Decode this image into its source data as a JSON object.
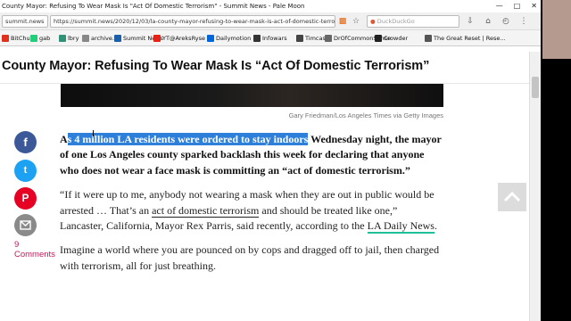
{
  "browser": {
    "tab_title": "County Mayor: Refusing To Wear Mask Is \"Act Of Domestic Terrorism\" - Summit News - Pale Moon",
    "site_identity": "summit.news",
    "url": "https://summit.news/2020/12/03/la-county-mayor-refusing-to-wear-mask-is-act-of-domestic-terrorism/",
    "search_placeholder": "DuckDuckGo"
  },
  "bookmarks": [
    {
      "label": "BitChute",
      "color": "#e0301e"
    },
    {
      "label": "gab",
      "color": "#21cf7a"
    },
    {
      "label": "lbry",
      "color": "#2f9176"
    },
    {
      "label": "archive.is",
      "color": "#888888"
    },
    {
      "label": "Summit News",
      "color": "#1b5fa8"
    },
    {
      "label": "YT@AreksRyse",
      "color": "#e62117"
    },
    {
      "label": "Dailymotion",
      "color": "#0066dc"
    },
    {
      "label": "Infowars",
      "color": "#333333"
    },
    {
      "label": "Timcast",
      "color": "#444444"
    },
    {
      "label": "DrOfCommonSense",
      "color": "#666666"
    },
    {
      "label": "Crowder",
      "color": "#222222"
    },
    {
      "label": "The Great Reset | Rese...",
      "color": "#555555"
    }
  ],
  "article": {
    "headline": "County Mayor: Refusing To Wear Mask Is “Act Of Domestic Terrorism”",
    "photo_credit": "Gary Friedman/Los Angeles Times via Getty Images",
    "lead_first": "A",
    "lead_highlight": "s 4 million LA residents were ordered to stay indoors",
    "lead_rest": " Wednesday night, the mayor of one Los Angeles county sparked backlash this week for declaring that anyone who does not wear a face mask is committing an “act of domestic terrorism.”",
    "p2_a": "“If it were up to me, anybody not wearing a mask when they are out in public would be arrested … That’s an ",
    "p2_link": "act of domestic terrorism",
    "p2_b": " and should be treated like one,” Lancaster, California, Mayor Rex Parris, said recently, according to the ",
    "p2_source": "LA Daily News",
    "p2_end": ".",
    "p3": "Imagine a world where you are pounced on by cops and dragged off to jail, then charged with terrorism, all for just breathing."
  },
  "share": {
    "facebook": "f",
    "twitter": "t",
    "pinterest": "P",
    "email": "email-icon",
    "comment_count": "9",
    "comments_label": "Comments"
  }
}
